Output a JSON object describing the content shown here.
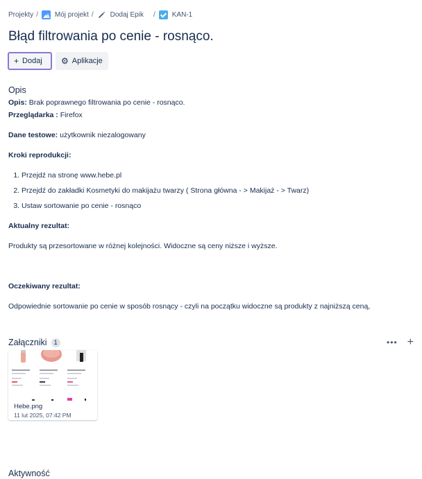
{
  "breadcrumb": {
    "items": [
      {
        "label": "Projekty",
        "icon": ""
      },
      {
        "label": "Mój projekt",
        "icon": "project-icon"
      },
      {
        "label": "Dodaj Epik",
        "icon": "pencil-icon"
      },
      {
        "label": "KAN-1",
        "icon": "task-checkbox-icon"
      }
    ],
    "separator": "/"
  },
  "issue": {
    "title": "Błąd filtrowania po cenie - rosnąco."
  },
  "actions": {
    "add_label": "Dodaj",
    "apps_label": "Aplikacje"
  },
  "description": {
    "heading": "Opis",
    "opis_label": "Opis:",
    "opis_value": " Brak poprawnego filtrowania po cenie - rosnąco.",
    "browser_label": "Przeglądarka :",
    "browser_value": " Firefox",
    "testdata_label": "Dane testowe:",
    "testdata_value": " użytkownik niezalogowany",
    "steps_label": "Kroki reprodukcji:",
    "steps": [
      "Przejdź na stronę www.hebe.pl",
      "Przejdź do zakładki Kosmetyki do makijażu twarzy ( Strona główna - > Makijaż - > Twarz)",
      "Ustaw sortowanie po cenie - rosnąco"
    ],
    "actual_label": "Aktualny rezultat:",
    "actual_value": "Produkty są przesortowane w różnej kolejności. Widoczne są ceny niższe i wyższe.",
    "expected_label": "Oczekiwany rezultat:",
    "expected_value": "Odpowiednie sortowanie po cenie w sposób rosnący - czyli na początku widoczne są produkty z najniższą ceną,"
  },
  "attachments": {
    "heading": "Załączniki",
    "count": "1",
    "more_icon": "more-icon",
    "add_icon": "plus-icon",
    "items": [
      {
        "file_name": "Hebe.png",
        "date": "11 lut 2025, 07:42 PM"
      }
    ]
  },
  "activity": {
    "heading": "Aktywność"
  },
  "colors": {
    "accent": "#8777d9",
    "text": "#172b4d",
    "subtle": "#44546f",
    "task_icon": "#4bade8",
    "project_icon": "#4c9aff"
  }
}
